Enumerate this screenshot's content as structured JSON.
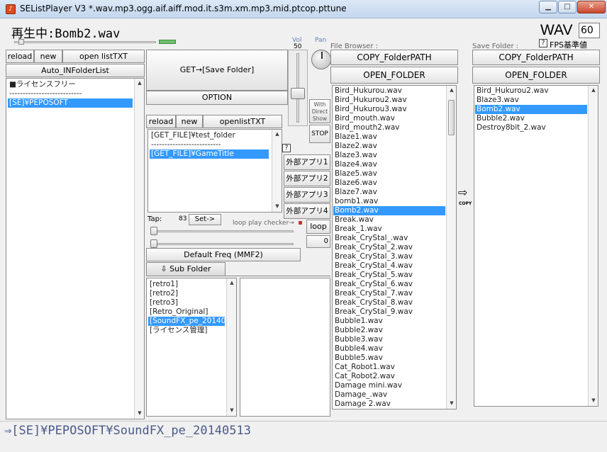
{
  "window": {
    "title": "SEListPlayer V3   *.wav.mp3.ogg.aif.aiff.mod.it.s3m.xm.mp3.mid.ptcop.pttune",
    "app_icon": "♪"
  },
  "header": {
    "now_playing": "再生中:Bomb2.wav",
    "format": "WAV",
    "fps": "60",
    "fps_label": "FPS基準値"
  },
  "left_panel": {
    "reload": "reload",
    "new": "new",
    "open": "open listTXT",
    "auto": "Auto_INFolderList",
    "items": [
      "■ライセンスフリー",
      "---------------------------",
      "[SE]¥PEPOSOFT"
    ],
    "selected": 2
  },
  "middle": {
    "get_label": "GET→[Save Folder]",
    "option": "OPTION",
    "reload": "reload",
    "new": "new",
    "open": "openlistTXT",
    "items": [
      "[GET_FILE]¥test_folder",
      "--------------------------",
      "[GET_FILE]¥GameTitle"
    ],
    "selected": 2,
    "apps": [
      "外部アプリ1",
      "外部アプリ2",
      "外部アプリ3",
      "外部アプリ4"
    ],
    "vol_label": "Vol",
    "vol_value": "50",
    "pan_label": "Pan",
    "with_direct_show": "With Direct Show",
    "stop": "STOP",
    "help": "?",
    "tap_label": "Tap:",
    "tap_value": "83",
    "set": "Set->",
    "loop_checker": "loop play checker→",
    "loop": "loop",
    "loop_count": "0",
    "default_freq": "Default Freq (MMF2)",
    "sub_folder_tab": "⇩ Sub Folder",
    "sub_folders": [
      "[retro1]",
      "[retro2]",
      "[retro3]",
      "[Retro_Original]",
      "[SoundFX_pe_20140",
      "[ライセンス管理]"
    ],
    "sub_selected": 4
  },
  "file_browser": {
    "label": "File Browser :",
    "copy_path": "COPY_FolderPATH",
    "open_folder": "OPEN_FOLDER",
    "files": [
      "Bird_Hukurou.wav",
      "Bird_Hukurou2.wav",
      "Bird_Hukurou3.wav",
      "Bird_mouth.wav",
      "Bird_mouth2.wav",
      "Blaze1.wav",
      "Blaze2.wav",
      "Blaze3.wav",
      "Blaze4.wav",
      "Blaze5.wav",
      "Blaze6.wav",
      "Blaze7.wav",
      "bomb1.wav",
      "Bomb2.wav",
      "Break.wav",
      "Break_1.wav",
      "Break_CryStal_.wav",
      "Break_CryStal_2.wav",
      "Break_CryStal_3.wav",
      "Break_CryStal_4.wav",
      "Break_CryStal_5.wav",
      "Break_CryStal_6.wav",
      "Break_CryStal_7.wav",
      "Break_CryStal_8.wav",
      "Break_CryStal_9.wav",
      "Bubble1.wav",
      "Bubble2.wav",
      "Bubble3.wav",
      "Bubble4.wav",
      "Bubble5.wav",
      "Cat_Robot1.wav",
      "Cat_Robot2.wav",
      "Damage mini.wav",
      "Damage_.wav",
      "Damage 2.wav"
    ],
    "selected": 13
  },
  "copy_arrow": {
    "arrow": "⇨",
    "label": "COPY"
  },
  "save_folder": {
    "label": "Save Folder :",
    "copy_path": "COPY_FolderPATH",
    "open_folder": "OPEN_FOLDER",
    "files": [
      "Bird_Hukurou2.wav",
      "Blaze3.wav",
      "Bomb2.wav",
      "Bubble2.wav",
      "Destroy8bit_2.wav"
    ],
    "selected": 2
  },
  "status_path": "⇒[SE]¥PEPOSOFT¥SoundFX_pe_20140513",
  "colors": {
    "selection": "#3399ff",
    "path_text": "#4a5a8a"
  }
}
